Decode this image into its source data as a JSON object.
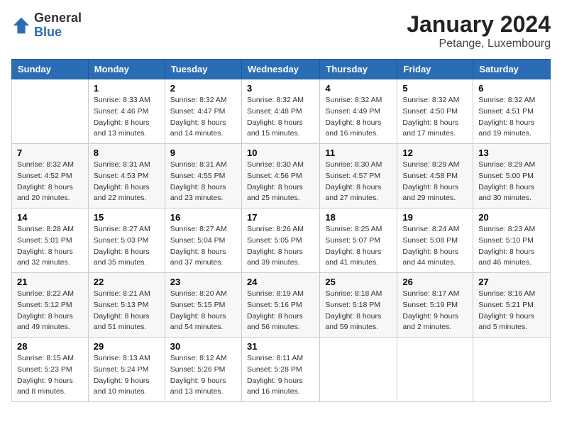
{
  "logo": {
    "general": "General",
    "blue": "Blue"
  },
  "title": "January 2024",
  "subtitle": "Petange, Luxembourg",
  "weekdays": [
    "Sunday",
    "Monday",
    "Tuesday",
    "Wednesday",
    "Thursday",
    "Friday",
    "Saturday"
  ],
  "weeks": [
    [
      {
        "day": "",
        "info": ""
      },
      {
        "day": "1",
        "info": "Sunrise: 8:33 AM\nSunset: 4:46 PM\nDaylight: 8 hours\nand 13 minutes."
      },
      {
        "day": "2",
        "info": "Sunrise: 8:32 AM\nSunset: 4:47 PM\nDaylight: 8 hours\nand 14 minutes."
      },
      {
        "day": "3",
        "info": "Sunrise: 8:32 AM\nSunset: 4:48 PM\nDaylight: 8 hours\nand 15 minutes."
      },
      {
        "day": "4",
        "info": "Sunrise: 8:32 AM\nSunset: 4:49 PM\nDaylight: 8 hours\nand 16 minutes."
      },
      {
        "day": "5",
        "info": "Sunrise: 8:32 AM\nSunset: 4:50 PM\nDaylight: 8 hours\nand 17 minutes."
      },
      {
        "day": "6",
        "info": "Sunrise: 8:32 AM\nSunset: 4:51 PM\nDaylight: 8 hours\nand 19 minutes."
      }
    ],
    [
      {
        "day": "7",
        "info": "Sunrise: 8:32 AM\nSunset: 4:52 PM\nDaylight: 8 hours\nand 20 minutes."
      },
      {
        "day": "8",
        "info": "Sunrise: 8:31 AM\nSunset: 4:53 PM\nDaylight: 8 hours\nand 22 minutes."
      },
      {
        "day": "9",
        "info": "Sunrise: 8:31 AM\nSunset: 4:55 PM\nDaylight: 8 hours\nand 23 minutes."
      },
      {
        "day": "10",
        "info": "Sunrise: 8:30 AM\nSunset: 4:56 PM\nDaylight: 8 hours\nand 25 minutes."
      },
      {
        "day": "11",
        "info": "Sunrise: 8:30 AM\nSunset: 4:57 PM\nDaylight: 8 hours\nand 27 minutes."
      },
      {
        "day": "12",
        "info": "Sunrise: 8:29 AM\nSunset: 4:58 PM\nDaylight: 8 hours\nand 29 minutes."
      },
      {
        "day": "13",
        "info": "Sunrise: 8:29 AM\nSunset: 5:00 PM\nDaylight: 8 hours\nand 30 minutes."
      }
    ],
    [
      {
        "day": "14",
        "info": "Sunrise: 8:28 AM\nSunset: 5:01 PM\nDaylight: 8 hours\nand 32 minutes."
      },
      {
        "day": "15",
        "info": "Sunrise: 8:27 AM\nSunset: 5:03 PM\nDaylight: 8 hours\nand 35 minutes."
      },
      {
        "day": "16",
        "info": "Sunrise: 8:27 AM\nSunset: 5:04 PM\nDaylight: 8 hours\nand 37 minutes."
      },
      {
        "day": "17",
        "info": "Sunrise: 8:26 AM\nSunset: 5:05 PM\nDaylight: 8 hours\nand 39 minutes."
      },
      {
        "day": "18",
        "info": "Sunrise: 8:25 AM\nSunset: 5:07 PM\nDaylight: 8 hours\nand 41 minutes."
      },
      {
        "day": "19",
        "info": "Sunrise: 8:24 AM\nSunset: 5:08 PM\nDaylight: 8 hours\nand 44 minutes."
      },
      {
        "day": "20",
        "info": "Sunrise: 8:23 AM\nSunset: 5:10 PM\nDaylight: 8 hours\nand 46 minutes."
      }
    ],
    [
      {
        "day": "21",
        "info": "Sunrise: 8:22 AM\nSunset: 5:12 PM\nDaylight: 8 hours\nand 49 minutes."
      },
      {
        "day": "22",
        "info": "Sunrise: 8:21 AM\nSunset: 5:13 PM\nDaylight: 8 hours\nand 51 minutes."
      },
      {
        "day": "23",
        "info": "Sunrise: 8:20 AM\nSunset: 5:15 PM\nDaylight: 8 hours\nand 54 minutes."
      },
      {
        "day": "24",
        "info": "Sunrise: 8:19 AM\nSunset: 5:16 PM\nDaylight: 8 hours\nand 56 minutes."
      },
      {
        "day": "25",
        "info": "Sunrise: 8:18 AM\nSunset: 5:18 PM\nDaylight: 8 hours\nand 59 minutes."
      },
      {
        "day": "26",
        "info": "Sunrise: 8:17 AM\nSunset: 5:19 PM\nDaylight: 9 hours\nand 2 minutes."
      },
      {
        "day": "27",
        "info": "Sunrise: 8:16 AM\nSunset: 5:21 PM\nDaylight: 9 hours\nand 5 minutes."
      }
    ],
    [
      {
        "day": "28",
        "info": "Sunrise: 8:15 AM\nSunset: 5:23 PM\nDaylight: 9 hours\nand 8 minutes."
      },
      {
        "day": "29",
        "info": "Sunrise: 8:13 AM\nSunset: 5:24 PM\nDaylight: 9 hours\nand 10 minutes."
      },
      {
        "day": "30",
        "info": "Sunrise: 8:12 AM\nSunset: 5:26 PM\nDaylight: 9 hours\nand 13 minutes."
      },
      {
        "day": "31",
        "info": "Sunrise: 8:11 AM\nSunset: 5:28 PM\nDaylight: 9 hours\nand 16 minutes."
      },
      {
        "day": "",
        "info": ""
      },
      {
        "day": "",
        "info": ""
      },
      {
        "day": "",
        "info": ""
      }
    ]
  ]
}
